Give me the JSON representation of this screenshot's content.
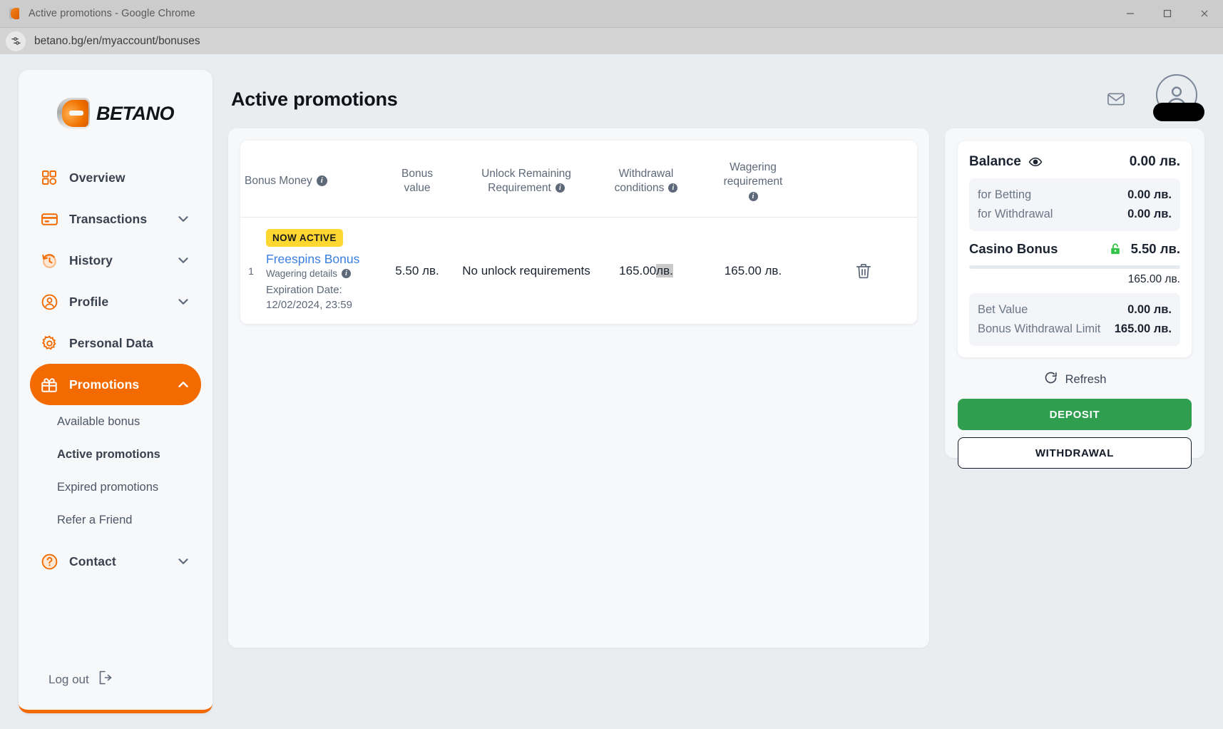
{
  "browser": {
    "window_title": "Active promotions - Google Chrome",
    "url": "betano.bg/en/myaccount/bonuses",
    "minimize_label": "Minimize",
    "maximize_label": "Maximize",
    "close_label": "Close"
  },
  "sidebar": {
    "brand": "BETANO",
    "items": [
      {
        "label": "Overview",
        "icon": "grid-icon",
        "expandable": false,
        "active": false
      },
      {
        "label": "Transactions",
        "icon": "card-icon",
        "expandable": true,
        "active": false
      },
      {
        "label": "History",
        "icon": "history-icon",
        "expandable": true,
        "active": false
      },
      {
        "label": "Profile",
        "icon": "person-icon",
        "expandable": true,
        "active": false
      },
      {
        "label": "Personal Data",
        "icon": "gear-icon",
        "expandable": false,
        "active": false
      },
      {
        "label": "Promotions",
        "icon": "gift-icon",
        "expandable": true,
        "active": true
      }
    ],
    "sub_items": [
      {
        "label": "Available bonus",
        "current": false
      },
      {
        "label": "Active promotions",
        "current": true
      },
      {
        "label": "Expired promotions",
        "current": false
      },
      {
        "label": "Refer a Friend",
        "current": false
      }
    ],
    "contact": {
      "label": "Contact",
      "icon": "question-icon",
      "expandable": true
    },
    "logout": {
      "label": "Log out",
      "icon": "logout-icon"
    }
  },
  "header": {
    "title": "Active promotions",
    "mail_icon": "envelope-icon",
    "avatar_icon": "user-avatar-icon"
  },
  "table": {
    "columns": {
      "name": "Bonus Money",
      "value_line1": "Bonus",
      "value_line2": "value",
      "unlock_line1": "Unlock Remaining",
      "unlock_line2": "Requirement",
      "withdraw_line1": "Withdrawal",
      "withdraw_line2": "conditions",
      "wager_line1": "Wagering",
      "wager_line2": "requirement"
    },
    "rows": [
      {
        "index": "1",
        "badge": "NOW ACTIVE",
        "name": "Freespins Bonus",
        "details_link": "Wagering details",
        "expiration_label": "Expiration Date:",
        "expiration_date": "12/02/2024, 23:59",
        "bonus_value": "5.50 лв.",
        "unlock_requirement": "No unlock requirements",
        "withdrawal_amount": "165.00",
        "withdrawal_currency": "лв.",
        "wagering_requirement": "165.00 лв.",
        "delete_icon": "trash-icon"
      }
    ]
  },
  "balance": {
    "title": "Balance",
    "eye_icon": "eye-icon",
    "total": "0.00 лв.",
    "breakdown": [
      {
        "label": "for Betting",
        "value": "0.00 лв."
      },
      {
        "label": "for Withdrawal",
        "value": "0.00 лв."
      }
    ],
    "casino_bonus_label": "Casino Bonus",
    "casino_bonus_value": "5.50 лв.",
    "casino_lock_icon": "unlock-icon",
    "progress_max": "165.00 лв.",
    "progress_percent": 0,
    "details": [
      {
        "label": "Bet Value",
        "value": "0.00 лв."
      },
      {
        "label": "Bonus Withdrawal Limit",
        "value": "165.00 лв."
      }
    ],
    "refresh_label": "Refresh",
    "refresh_icon": "refresh-icon",
    "deposit_label": "DEPOSIT",
    "withdrawal_label": "WITHDRAWAL"
  },
  "colors": {
    "brand_orange": "#f26a00",
    "deposit_green": "#2f9e4f",
    "badge_yellow": "#ffd731",
    "link_blue": "#3a7fe0",
    "lock_green": "#35c44a"
  }
}
